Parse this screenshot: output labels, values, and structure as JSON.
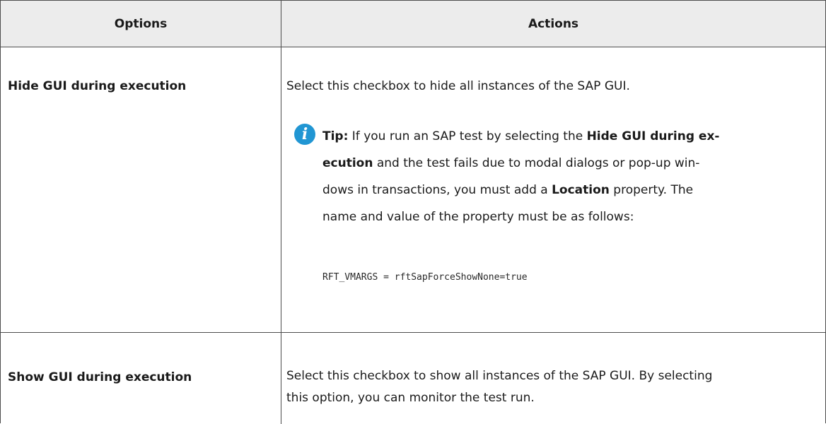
{
  "table": {
    "headers": {
      "options": "Options",
      "actions": "Actions"
    },
    "rows": [
      {
        "option": "Hide GUI during execution",
        "action": "Select this checkbox to hide all instances of the SAP GUI.",
        "tip": {
          "icon": "info-icon",
          "label": "Tip:",
          "t1": " If you run an SAP test by selecting the ",
          "b1": "Hide GUI during ex-",
          "b2": "ecution",
          "t2": " and the test fails due to modal dialogs or pop-up win-",
          "t3": "dows in transactions, you must add a ",
          "b3": "Location",
          "t4": " property. The",
          "t5": "name and value of the property must be as follows:"
        },
        "code": "RFT_VMARGS = rftSapForceShowNone=true"
      },
      {
        "option": "Show GUI during execution",
        "action_line1": "Select this checkbox to show all instances of the SAP GUI. By selecting",
        "action_line2": "this option, you can monitor the test run."
      }
    ]
  },
  "colors": {
    "header_bg": "#ececec",
    "border": "#4d4d4d",
    "tip_icon": "#2196d3"
  }
}
